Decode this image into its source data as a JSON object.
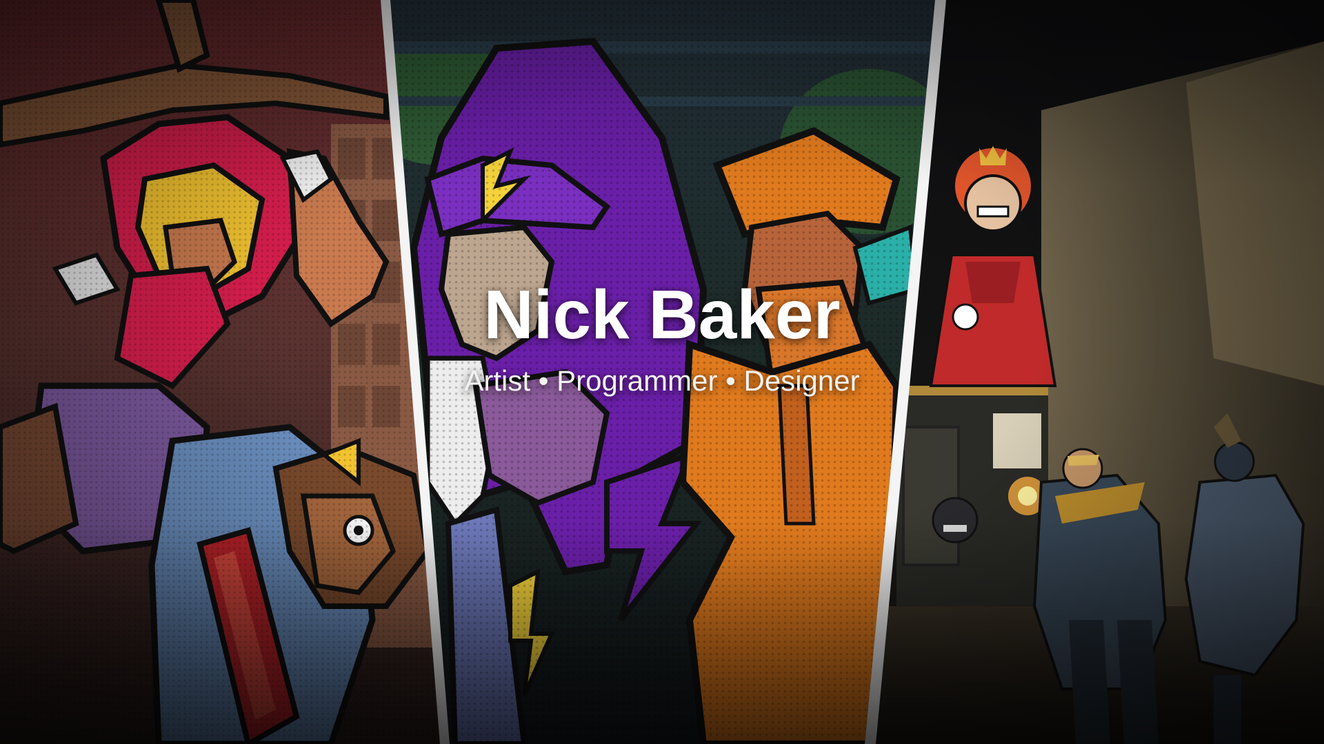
{
  "hero": {
    "title": "Nick Baker",
    "subtitle": "Artist • Programmer • Designer"
  },
  "panels": [
    {
      "name": "left-comic-art",
      "palette": [
        "#7a2c33",
        "#d81e4d",
        "#f2c230",
        "#7d5aa0",
        "#6b8fbf",
        "#8b4a2b"
      ]
    },
    {
      "name": "center-comic-art",
      "palette": [
        "#2a5a3a",
        "#6a1fa8",
        "#e07a1e",
        "#f4d23a",
        "#b85a2c"
      ]
    },
    {
      "name": "right-game-screenshot",
      "palette": [
        "#1a1a1a",
        "#c02a2a",
        "#e26a2c",
        "#8a7a55",
        "#3e4e5e"
      ]
    }
  ],
  "colors": {
    "divider": "#f4f4f4",
    "text": "#ffffff"
  }
}
